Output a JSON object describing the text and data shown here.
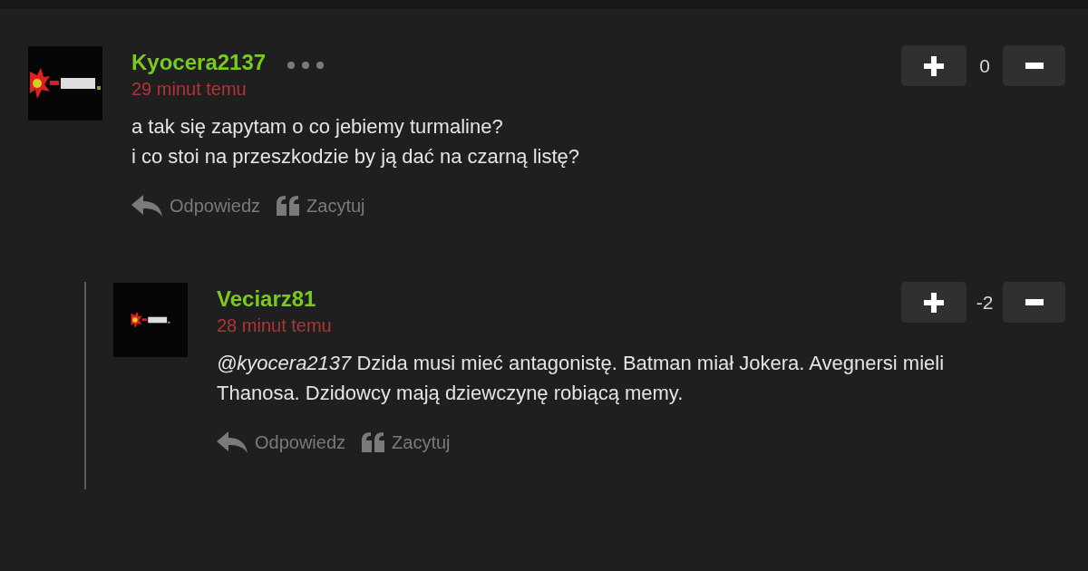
{
  "comments": [
    {
      "author": "Kyocera2137",
      "has_menu": true,
      "time": "29 minut temu",
      "body": [
        "a tak się zapytam o co jebiemy turmaline?",
        "i co stoi na przeszkodzie by ją dać na czarną listę?"
      ],
      "score": "0",
      "actions": [
        {
          "kind": "reply",
          "label": "Odpowiedz"
        },
        {
          "kind": "quote",
          "label": "Zacytuj"
        }
      ],
      "children": [
        {
          "author": "Veciarz81",
          "has_menu": false,
          "time": "28 minut temu",
          "body": [
            "*@kyocera2137* Dzida musi mieć antagonistę. Batman miał Jokera. Avegnersi mieli Thanosa. Dzidowcy mają dziewczynę robiącą memy."
          ],
          "score": "-2",
          "actions": [
            {
              "kind": "reply",
              "label": "Odpowiedz"
            },
            {
              "kind": "quote",
              "label": "Zacytuj"
            }
          ]
        }
      ]
    }
  ]
}
